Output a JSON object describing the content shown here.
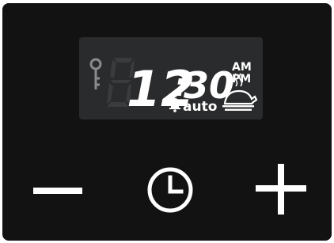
{
  "display": {
    "time_hours": "12",
    "time_separator": ":",
    "time_minutes": "30",
    "am_label": "AM",
    "pm_label": "PM",
    "auto_label": "auto"
  },
  "icons": {
    "key": "key-icon",
    "bell": "bell-icon",
    "roast": "roast-chicken-icon",
    "minus": "minus-icon",
    "clock": "clock-icon",
    "plus": "plus-icon"
  },
  "colors": {
    "panel": "#121212",
    "lcd_background": "#2a2b2c",
    "segment_on": "#ffffff",
    "segment_off": "#3a3b3c"
  }
}
